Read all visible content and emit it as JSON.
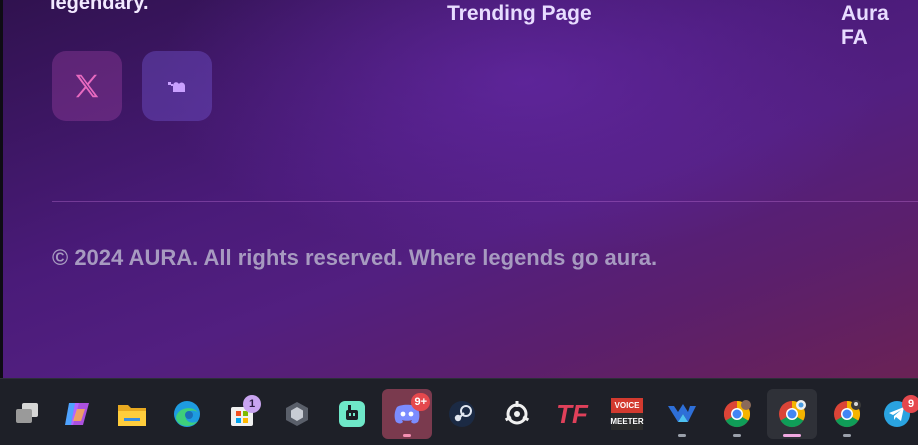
{
  "footer": {
    "tagline": "legendary.",
    "links": [
      "Trending Page",
      "Aura FA"
    ],
    "copyright": "© 2024 AURA. All rights reserved. Where legends go aura."
  },
  "social": [
    {
      "name": "X",
      "icon": "x-logo-icon",
      "color": "#e86ac0"
    },
    {
      "name": "Kick",
      "icon": "kick-logo-icon",
      "color": "#c9a0ff"
    }
  ],
  "taskbar": {
    "items": [
      {
        "name": "Task View",
        "icon": "task-view-icon"
      },
      {
        "name": "Copilot",
        "icon": "copilot-icon"
      },
      {
        "name": "File Explorer",
        "icon": "folder-icon"
      },
      {
        "name": "Edge",
        "icon": "edge-icon"
      },
      {
        "name": "Microsoft Store",
        "icon": "store-icon",
        "badge": "1"
      },
      {
        "name": "Unknown App",
        "icon": "cube-icon"
      },
      {
        "name": "App",
        "icon": "app-icon"
      },
      {
        "name": "Discord",
        "icon": "discord-icon",
        "badge": "9+"
      },
      {
        "name": "Steam",
        "icon": "steam-icon"
      },
      {
        "name": "SteelSeries",
        "icon": "steelseries-icon"
      },
      {
        "name": "TF",
        "icon": "tf-icon",
        "label": "TF"
      },
      {
        "name": "Voicemeeter",
        "icon": "voicemeeter-icon",
        "label_top": "VOICE",
        "label_bottom": "MEETER"
      },
      {
        "name": "App",
        "icon": "wave-icon"
      },
      {
        "name": "Chrome",
        "icon": "chrome-icon"
      },
      {
        "name": "Chrome",
        "icon": "chrome-icon"
      },
      {
        "name": "Chrome",
        "icon": "chrome-icon"
      },
      {
        "name": "Telegram",
        "icon": "telegram-icon",
        "badge": "9"
      }
    ]
  }
}
